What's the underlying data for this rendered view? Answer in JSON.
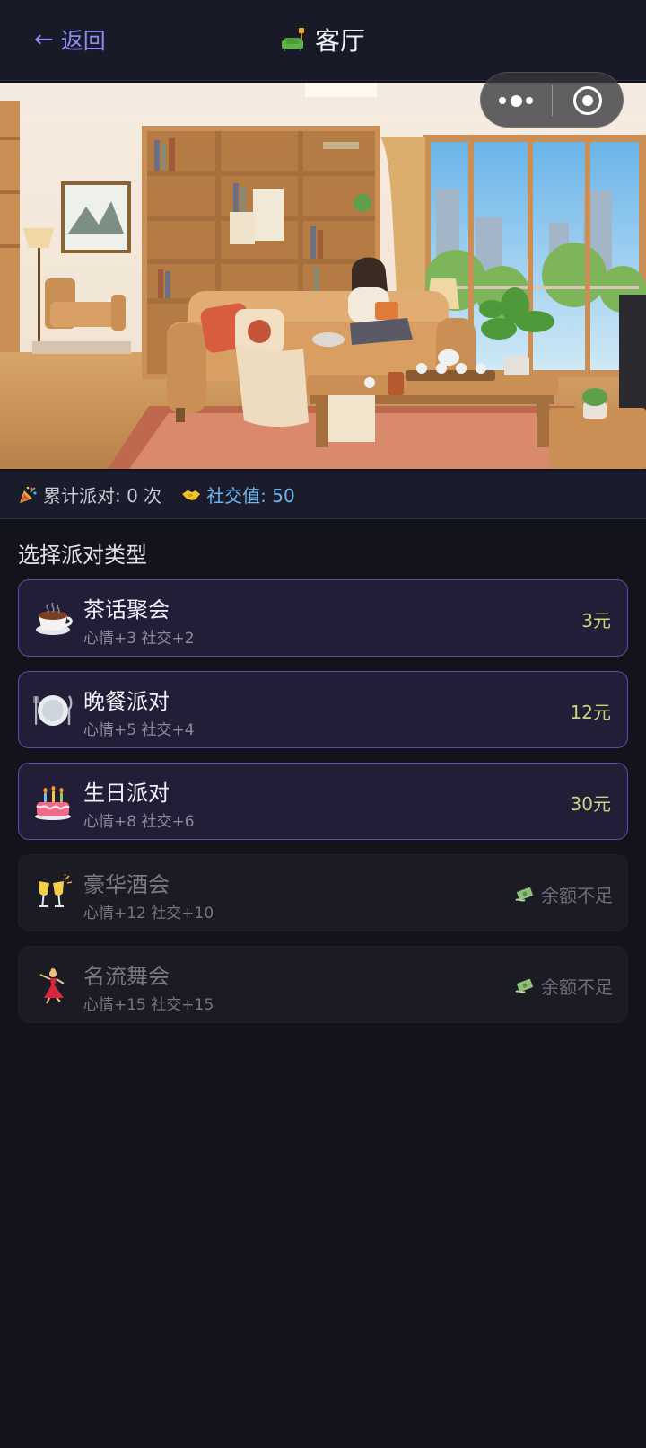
{
  "header": {
    "back_label": "返回",
    "title": "客厅",
    "title_icon": "sofa-icon"
  },
  "capsule": {
    "more_icon": "more-dots-icon",
    "close_icon": "target-icon"
  },
  "scene": {
    "description_icon": "living-room-illustration"
  },
  "stats": {
    "parties_label": "累计派对: 0 次",
    "parties_icon": "party-popper-icon",
    "social_label": "社交值: 50",
    "social_icon": "handshake-icon"
  },
  "section_title": "选择派对类型",
  "parties": [
    {
      "name": "茶话聚会",
      "effect": "心情+3 社交+2",
      "price": "3元",
      "icon": "tea-icon",
      "enabled": true
    },
    {
      "name": "晚餐派对",
      "effect": "心情+5 社交+4",
      "price": "12元",
      "icon": "dinner-plate-icon",
      "enabled": true
    },
    {
      "name": "生日派对",
      "effect": "心情+8 社交+6",
      "price": "30元",
      "icon": "birthday-cake-icon",
      "enabled": true
    },
    {
      "name": "豪华酒会",
      "effect": "心情+12 社交+10",
      "status": "余额不足",
      "icon": "champagne-glasses-icon",
      "enabled": false
    },
    {
      "name": "名流舞会",
      "effect": "心情+15 社交+15",
      "status": "余额不足",
      "icon": "dancer-icon",
      "enabled": false
    }
  ],
  "colors": {
    "background": "#13131c",
    "accent": "#8b8bf0",
    "card_border": "#5a4ea8",
    "price": "#c6d67a",
    "social": "#6eb4ef"
  }
}
